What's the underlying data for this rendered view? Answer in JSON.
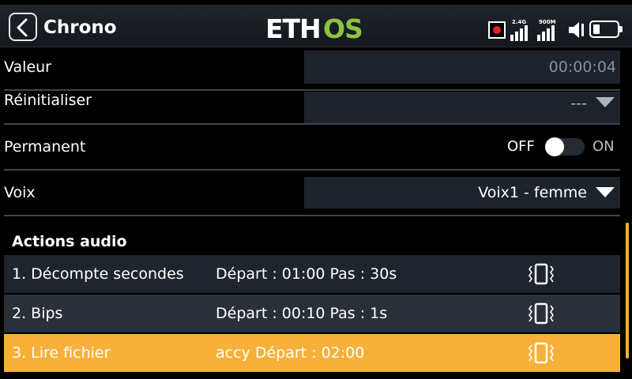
{
  "header": {
    "title": "Chrono",
    "logo_text": "ETHOS",
    "status": {
      "signal1_label": "2.4G",
      "signal2_label": "900M"
    }
  },
  "settings": {
    "valeur": {
      "label": "Valeur",
      "value": "00:00:04"
    },
    "reinitialiser": {
      "label": "Réinitialiser",
      "value": "---"
    },
    "permanent": {
      "label": "Permanent",
      "off_label": "OFF",
      "on_label": "ON",
      "state": "off"
    },
    "voix": {
      "label": "Voix",
      "value": "Voix1 - femme"
    }
  },
  "audio_actions": {
    "title": "Actions audio",
    "items": [
      {
        "name": "1. Décompte secondes",
        "detail": "Départ : 01:00 Pas : 30s",
        "icon": "vibrate-icon"
      },
      {
        "name": "2. Bips",
        "detail": "Départ : 00:10 Pas : 1s",
        "icon": "vibrate-icon"
      },
      {
        "name": "3. Lire fichier",
        "detail": "accy Départ : 02:00",
        "icon": "vibrate-icon",
        "selected": true
      }
    ]
  },
  "colors": {
    "accent": "#f7b13a",
    "logo_green": "#8bc53f",
    "field_bg": "#1d232b",
    "row_bg": "#1f252c"
  }
}
